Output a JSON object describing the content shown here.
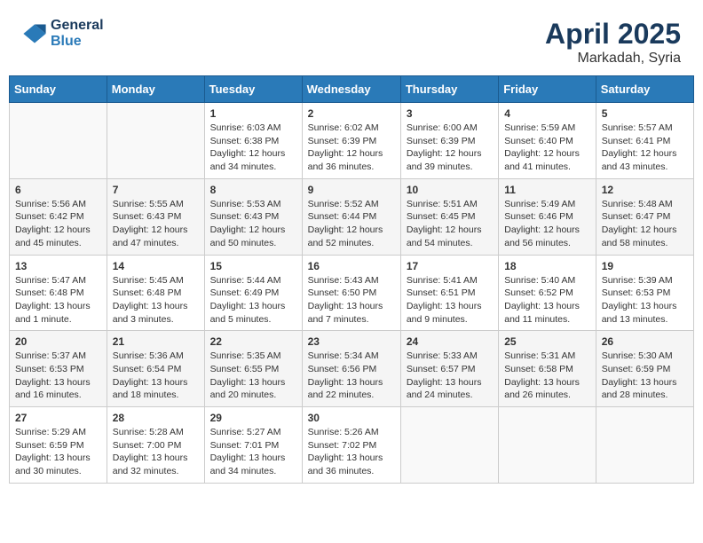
{
  "header": {
    "logo_line1": "General",
    "logo_line2": "Blue",
    "month": "April 2025",
    "location": "Markadah, Syria"
  },
  "weekdays": [
    "Sunday",
    "Monday",
    "Tuesday",
    "Wednesday",
    "Thursday",
    "Friday",
    "Saturday"
  ],
  "weeks": [
    [
      {
        "day": "",
        "info": ""
      },
      {
        "day": "",
        "info": ""
      },
      {
        "day": "1",
        "info": "Sunrise: 6:03 AM\nSunset: 6:38 PM\nDaylight: 12 hours and 34 minutes."
      },
      {
        "day": "2",
        "info": "Sunrise: 6:02 AM\nSunset: 6:39 PM\nDaylight: 12 hours and 36 minutes."
      },
      {
        "day": "3",
        "info": "Sunrise: 6:00 AM\nSunset: 6:39 PM\nDaylight: 12 hours and 39 minutes."
      },
      {
        "day": "4",
        "info": "Sunrise: 5:59 AM\nSunset: 6:40 PM\nDaylight: 12 hours and 41 minutes."
      },
      {
        "day": "5",
        "info": "Sunrise: 5:57 AM\nSunset: 6:41 PM\nDaylight: 12 hours and 43 minutes."
      }
    ],
    [
      {
        "day": "6",
        "info": "Sunrise: 5:56 AM\nSunset: 6:42 PM\nDaylight: 12 hours and 45 minutes."
      },
      {
        "day": "7",
        "info": "Sunrise: 5:55 AM\nSunset: 6:43 PM\nDaylight: 12 hours and 47 minutes."
      },
      {
        "day": "8",
        "info": "Sunrise: 5:53 AM\nSunset: 6:43 PM\nDaylight: 12 hours and 50 minutes."
      },
      {
        "day": "9",
        "info": "Sunrise: 5:52 AM\nSunset: 6:44 PM\nDaylight: 12 hours and 52 minutes."
      },
      {
        "day": "10",
        "info": "Sunrise: 5:51 AM\nSunset: 6:45 PM\nDaylight: 12 hours and 54 minutes."
      },
      {
        "day": "11",
        "info": "Sunrise: 5:49 AM\nSunset: 6:46 PM\nDaylight: 12 hours and 56 minutes."
      },
      {
        "day": "12",
        "info": "Sunrise: 5:48 AM\nSunset: 6:47 PM\nDaylight: 12 hours and 58 minutes."
      }
    ],
    [
      {
        "day": "13",
        "info": "Sunrise: 5:47 AM\nSunset: 6:48 PM\nDaylight: 13 hours and 1 minute."
      },
      {
        "day": "14",
        "info": "Sunrise: 5:45 AM\nSunset: 6:48 PM\nDaylight: 13 hours and 3 minutes."
      },
      {
        "day": "15",
        "info": "Sunrise: 5:44 AM\nSunset: 6:49 PM\nDaylight: 13 hours and 5 minutes."
      },
      {
        "day": "16",
        "info": "Sunrise: 5:43 AM\nSunset: 6:50 PM\nDaylight: 13 hours and 7 minutes."
      },
      {
        "day": "17",
        "info": "Sunrise: 5:41 AM\nSunset: 6:51 PM\nDaylight: 13 hours and 9 minutes."
      },
      {
        "day": "18",
        "info": "Sunrise: 5:40 AM\nSunset: 6:52 PM\nDaylight: 13 hours and 11 minutes."
      },
      {
        "day": "19",
        "info": "Sunrise: 5:39 AM\nSunset: 6:53 PM\nDaylight: 13 hours and 13 minutes."
      }
    ],
    [
      {
        "day": "20",
        "info": "Sunrise: 5:37 AM\nSunset: 6:53 PM\nDaylight: 13 hours and 16 minutes."
      },
      {
        "day": "21",
        "info": "Sunrise: 5:36 AM\nSunset: 6:54 PM\nDaylight: 13 hours and 18 minutes."
      },
      {
        "day": "22",
        "info": "Sunrise: 5:35 AM\nSunset: 6:55 PM\nDaylight: 13 hours and 20 minutes."
      },
      {
        "day": "23",
        "info": "Sunrise: 5:34 AM\nSunset: 6:56 PM\nDaylight: 13 hours and 22 minutes."
      },
      {
        "day": "24",
        "info": "Sunrise: 5:33 AM\nSunset: 6:57 PM\nDaylight: 13 hours and 24 minutes."
      },
      {
        "day": "25",
        "info": "Sunrise: 5:31 AM\nSunset: 6:58 PM\nDaylight: 13 hours and 26 minutes."
      },
      {
        "day": "26",
        "info": "Sunrise: 5:30 AM\nSunset: 6:59 PM\nDaylight: 13 hours and 28 minutes."
      }
    ],
    [
      {
        "day": "27",
        "info": "Sunrise: 5:29 AM\nSunset: 6:59 PM\nDaylight: 13 hours and 30 minutes."
      },
      {
        "day": "28",
        "info": "Sunrise: 5:28 AM\nSunset: 7:00 PM\nDaylight: 13 hours and 32 minutes."
      },
      {
        "day": "29",
        "info": "Sunrise: 5:27 AM\nSunset: 7:01 PM\nDaylight: 13 hours and 34 minutes."
      },
      {
        "day": "30",
        "info": "Sunrise: 5:26 AM\nSunset: 7:02 PM\nDaylight: 13 hours and 36 minutes."
      },
      {
        "day": "",
        "info": ""
      },
      {
        "day": "",
        "info": ""
      },
      {
        "day": "",
        "info": ""
      }
    ]
  ]
}
